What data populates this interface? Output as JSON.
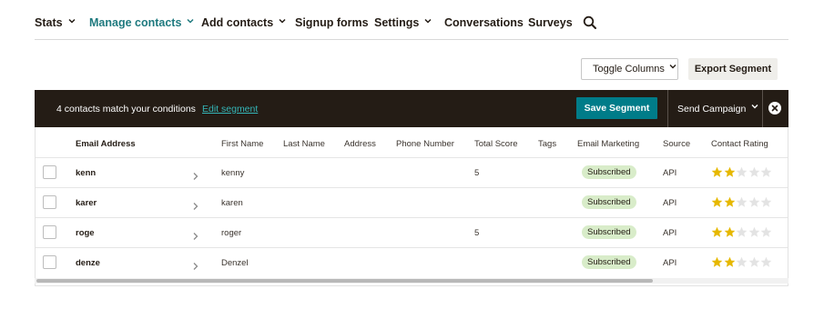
{
  "nav": {
    "items": [
      {
        "label": "Stats",
        "has_dropdown": true,
        "active": false
      },
      {
        "label": "Manage contacts",
        "has_dropdown": true,
        "active": true
      },
      {
        "label": "Add contacts",
        "has_dropdown": true,
        "active": false
      },
      {
        "label": "Signup forms",
        "has_dropdown": false,
        "active": false
      },
      {
        "label": "Settings",
        "has_dropdown": true,
        "active": false
      },
      {
        "label": "Conversations",
        "has_dropdown": false,
        "active": false
      },
      {
        "label": "Surveys",
        "has_dropdown": false,
        "active": false
      }
    ],
    "search_icon": "search-icon"
  },
  "actions": {
    "toggle_columns_label": "Toggle Columns",
    "export_segment_label": "Export Segment"
  },
  "segment_bar": {
    "count_text": "4 contacts match your conditions",
    "edit_link": "Edit segment",
    "save_label": "Save Segment",
    "send_campaign_label": "Send Campaign",
    "close_icon": "close-icon"
  },
  "table": {
    "columns": [
      "Email Address",
      "First Name",
      "Last Name",
      "Address",
      "Phone Number",
      "Total Score",
      "Tags",
      "Email Marketing",
      "Source",
      "Contact Rating"
    ],
    "rows": [
      {
        "email": "kenn",
        "first_name": "kenny",
        "last_name": "",
        "address": "",
        "phone": "",
        "total_score": "5",
        "tags": "",
        "email_marketing": "Subscribed",
        "source": "API",
        "rating": 2
      },
      {
        "email": "karer",
        "first_name": "karen",
        "last_name": "",
        "address": "",
        "phone": "",
        "total_score": "",
        "tags": "",
        "email_marketing": "Subscribed",
        "source": "API",
        "rating": 2
      },
      {
        "email": "roge",
        "first_name": "roger",
        "last_name": "",
        "address": "",
        "phone": "",
        "total_score": "5",
        "tags": "",
        "email_marketing": "Subscribed",
        "source": "API",
        "rating": 2
      },
      {
        "email": "denze",
        "first_name": "Denzel",
        "last_name": "",
        "address": "",
        "phone": "",
        "total_score": "",
        "tags": "",
        "email_marketing": "Subscribed",
        "source": "API",
        "rating": 2
      }
    ],
    "rating_max": 5
  },
  "colors": {
    "active_nav": "#1f7a7f",
    "segment_bar_bg": "#241c15",
    "save_button": "#007c89",
    "edit_link": "#34b6b8",
    "badge_bg": "#d8ecc9",
    "star_filled": "#e6b800",
    "star_empty": "#e3e3e3"
  },
  "scrollbar": {
    "thumb_fraction": 0.82
  }
}
